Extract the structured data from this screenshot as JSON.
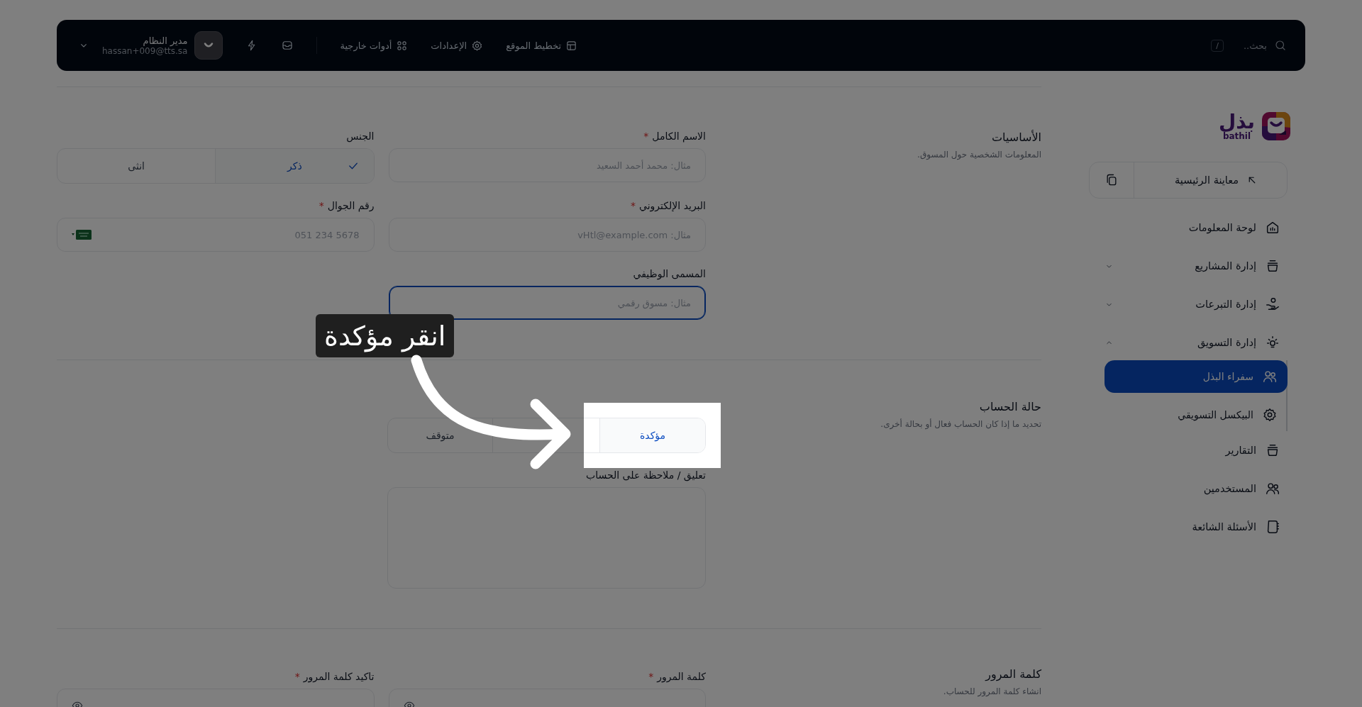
{
  "topbar": {
    "search_placeholder": "بحث..",
    "shortcut": "/",
    "links": [
      "تخطيط الموقع",
      "الإعدادات",
      "أدوات خارجية"
    ],
    "user": {
      "name": "مدير النظام",
      "email": "hassan+009@tts.sa"
    }
  },
  "sidebar": {
    "logo": {
      "name": "بذل",
      "sub": "bathil"
    },
    "preview": "معاينة الرئيسية",
    "items": [
      {
        "label": "لوحة المعلومات",
        "kind": "link",
        "selected": false
      },
      {
        "label": "إدارة المشاريع",
        "kind": "group",
        "expanded": false,
        "selected": false
      },
      {
        "label": "إدارة التبرعات",
        "kind": "group",
        "expanded": false,
        "selected": false
      },
      {
        "label": "إدارة التسويق",
        "kind": "group",
        "expanded": true,
        "selected": false,
        "children": [
          {
            "label": "سفراء البذل",
            "selected": true
          },
          {
            "label": "البيكسل التسويقي",
            "selected": false
          }
        ]
      },
      {
        "label": "التقارير",
        "kind": "link",
        "selected": false
      },
      {
        "label": "المستخدمين",
        "kind": "link",
        "selected": false
      },
      {
        "label": "الأسئلة الشائعة",
        "kind": "link",
        "selected": false
      }
    ]
  },
  "sections": [
    {
      "title": "الأساسيات",
      "description": "المعلومات الشخصية حول المسوق.",
      "fields": [
        {
          "kind": "text",
          "label": "الاسم الكامل",
          "required_mark": "*",
          "placeholder": "مثال: محمد أحمد السعيد",
          "focused": false
        },
        {
          "kind": "choice",
          "label": "الجنس",
          "options": [
            {
              "label": "ذكر",
              "selected": true
            },
            {
              "label": "انثى",
              "selected": false
            }
          ]
        },
        {
          "kind": "text",
          "label": "البريد الإلكتروني",
          "required_mark": "*",
          "placeholder": "مثال: vHtl@example.com",
          "focused": false
        },
        {
          "kind": "phone",
          "label": "رقم الجوال",
          "required_mark": "*",
          "placeholder": "051 234 5678",
          "focused": false
        },
        {
          "kind": "text",
          "label": "المسمى الوظيفي",
          "placeholder": "مثال: مسوق رقمي",
          "focused": true
        }
      ]
    },
    {
      "title": "حالة الحساب",
      "description": "تحديد ما إذا كان الحساب فعال أو بحالة أخرى.",
      "fields": [
        {
          "kind": "status",
          "options": [
            {
              "label": "مؤكدة",
              "selected": true
            },
            {
              "label": "متوقف",
              "selected": false
            }
          ]
        },
        {
          "kind": "textarea",
          "label": "تعليق / ملاحظة على الحساب"
        }
      ]
    },
    {
      "title": "كلمة المرور",
      "description": "انشاء كلمة المرور للحساب.",
      "fields": [
        {
          "kind": "password",
          "label": "كلمة المرور",
          "required_mark": "*"
        },
        {
          "kind": "password",
          "label": "تاكيد كلمة المرور",
          "required_mark": "*"
        }
      ]
    }
  ],
  "tutorial": {
    "hint": "انقر مؤكدة"
  }
}
